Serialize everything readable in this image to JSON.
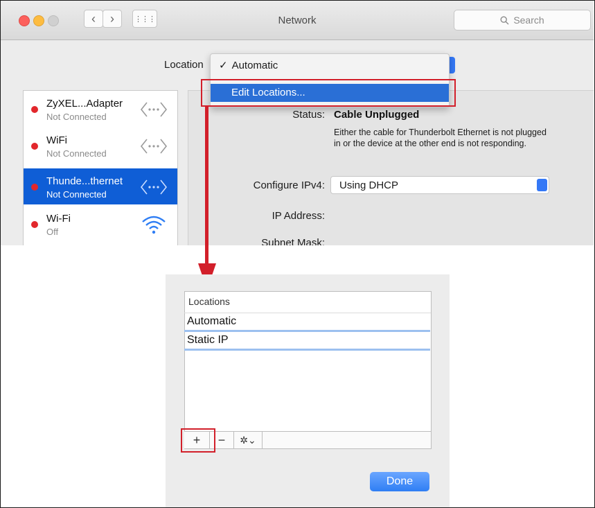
{
  "window": {
    "title": "Network",
    "search_placeholder": "Search",
    "nav_back": "‹",
    "nav_forward": "›",
    "grid_icon": "⋮⋮⋮"
  },
  "location": {
    "label": "Location",
    "current_check": "✓",
    "current": "Automatic",
    "edit_item": "Edit Locations..."
  },
  "services": [
    {
      "name": "ZyXEL...Adapter",
      "status": "Not Connected",
      "icon": "ethernet-icon",
      "selected": false
    },
    {
      "name": "WiFi",
      "status": "Not Connected",
      "icon": "ethernet-icon",
      "selected": false
    },
    {
      "name": "Thunde...thernet",
      "status": "Not Connected",
      "icon": "ethernet-icon",
      "selected": true
    },
    {
      "name": "Wi-Fi",
      "status": "Off",
      "icon": "wifi-icon",
      "selected": false
    }
  ],
  "detail": {
    "status_label": "Status:",
    "status_value": "Cable Unplugged",
    "status_desc": "Either the cable for Thunderbolt Ethernet is not plugged in or the device at the other end is not responding.",
    "ipv4_label": "Configure IPv4:",
    "ipv4_value": "Using DHCP",
    "ip_label": "IP Address:",
    "subnet_label": "Subnet Mask:"
  },
  "locations_sheet": {
    "header": "Locations",
    "items": [
      "Automatic",
      "Static IP"
    ],
    "add": "+",
    "remove": "−",
    "gear": "✲⌄",
    "done": "Done"
  },
  "colors": {
    "highlight_red": "#d21f2a",
    "selection_blue": "#0f5ed6",
    "status_red": "#e2272c",
    "done_blue": "#2f7ef4"
  }
}
